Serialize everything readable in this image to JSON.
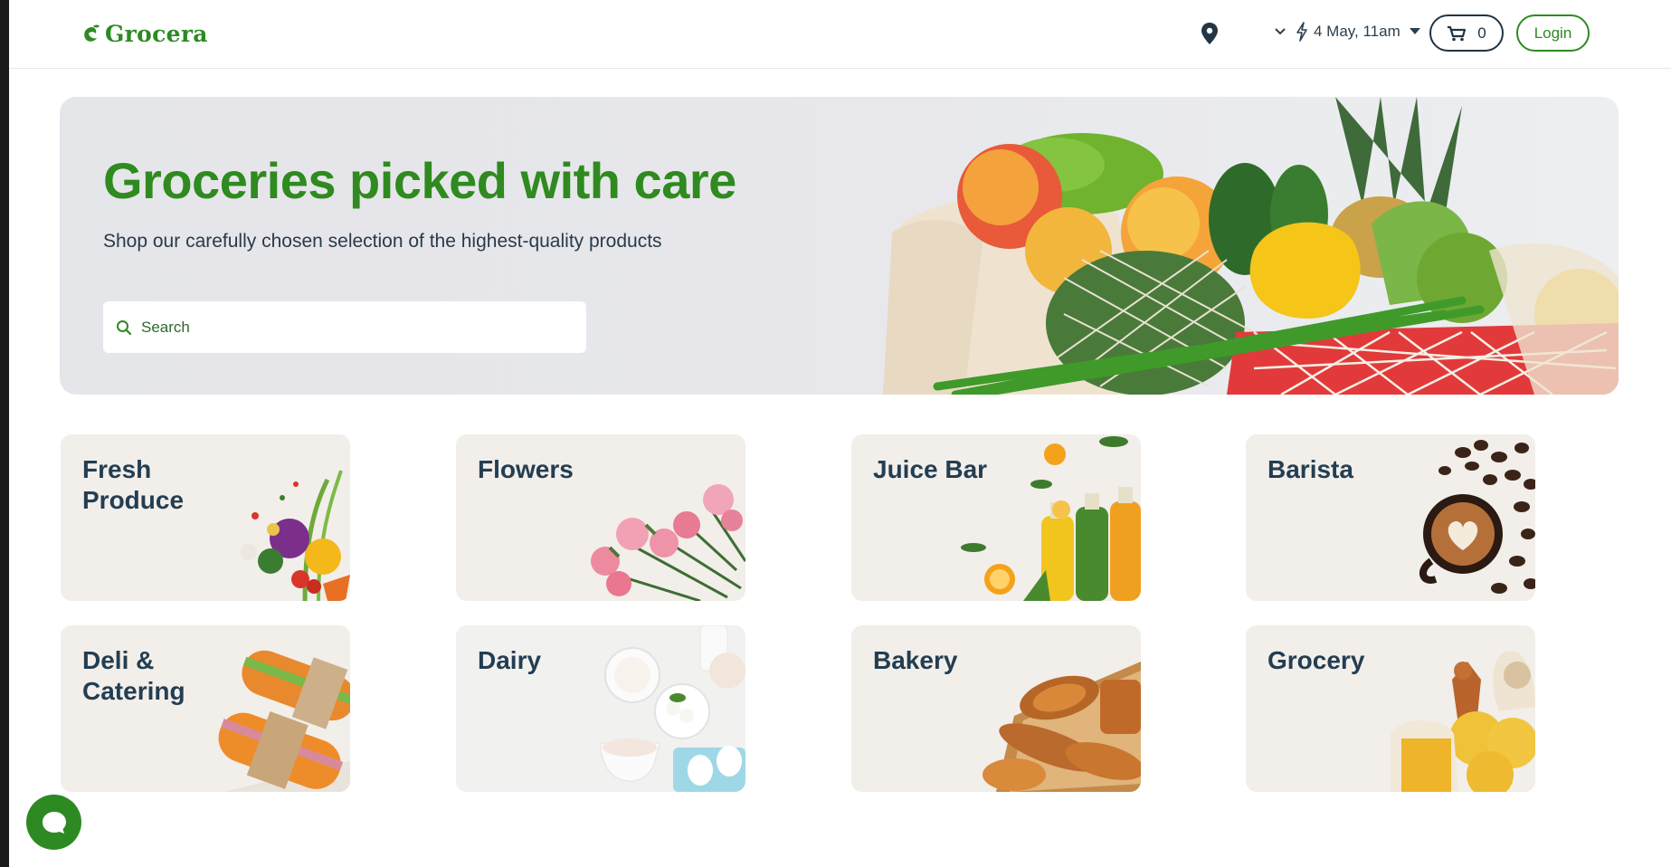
{
  "header": {
    "logo_text": "Grocera",
    "delivery_time": "4 May, 11am",
    "cart_count": "0",
    "login_label": "Login"
  },
  "hero": {
    "title": "Groceries picked with care",
    "subtitle": "Shop our carefully chosen selection of the highest-quality products",
    "search_placeholder": "Search"
  },
  "categories": [
    {
      "label": "Fresh Produce"
    },
    {
      "label": "Flowers"
    },
    {
      "label": "Juice Bar"
    },
    {
      "label": "Barista"
    },
    {
      "label": "Deli & Catering"
    },
    {
      "label": "Dairy"
    },
    {
      "label": "Bakery"
    },
    {
      "label": "Grocery"
    }
  ],
  "colors": {
    "brand_green": "#2d8a22",
    "title_navy": "#233e52",
    "card_bg": "#f2eeea"
  },
  "icons": [
    "logo-leaf-icon",
    "location-pin-icon",
    "chevron-down-icon",
    "lightning-icon",
    "caret-down-icon",
    "cart-icon",
    "search-icon",
    "chat-icon"
  ]
}
